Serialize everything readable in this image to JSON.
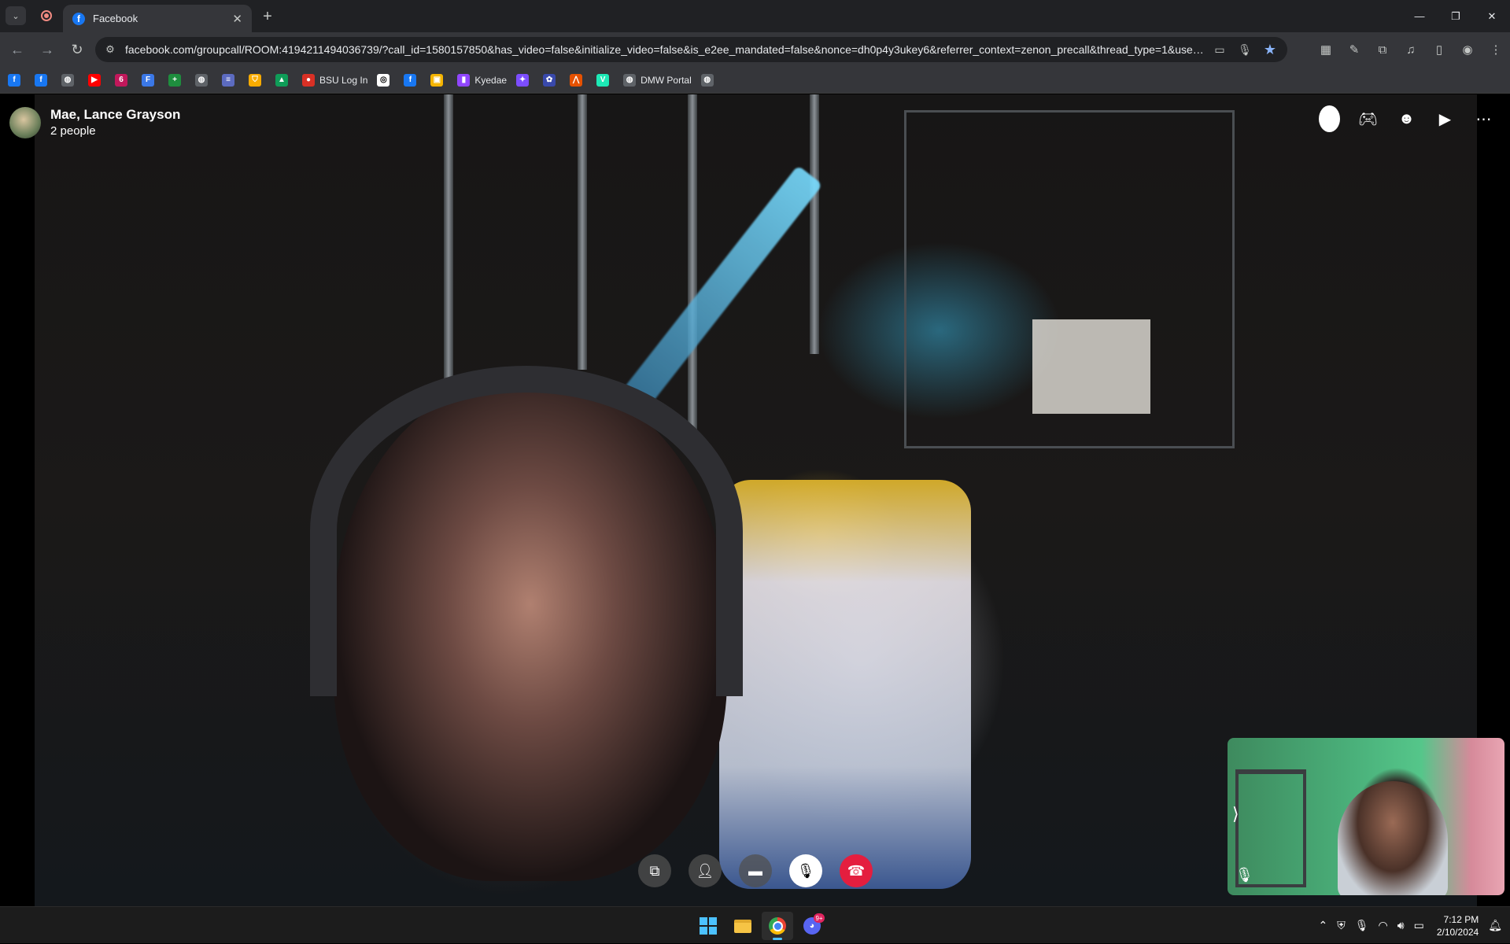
{
  "browser": {
    "tab": {
      "title": "Facebook",
      "close": "✕"
    },
    "new_tab": "+",
    "window_controls": {
      "minimize": "—",
      "restore": "❐",
      "close": "✕"
    },
    "address": {
      "host": "facebook.com",
      "path": "/groupcall/ROOM:4194211494036739/?call_id=1580157850&has_video=false&initialize_video=false&is_e2ee_mandated=false&nonce=dh0p4y3ukey6&referrer_context=zenon_precall&thread_type=1&users..."
    },
    "bookmarks": [
      {
        "label": "",
        "icon": "facebook",
        "color": "#1877f2",
        "glyph": "f"
      },
      {
        "label": "",
        "icon": "facebook",
        "color": "#1877f2",
        "glyph": "f"
      },
      {
        "label": "",
        "icon": "globe",
        "color": "#5f6368",
        "glyph": "◍"
      },
      {
        "label": "",
        "icon": "youtube",
        "color": "#ff0000",
        "glyph": "▶"
      },
      {
        "label": "",
        "icon": "app-624",
        "color": "#c2185b",
        "glyph": "6"
      },
      {
        "label": "",
        "icon": "forms",
        "color": "#3b78e7",
        "glyph": "F"
      },
      {
        "label": "",
        "icon": "sheets",
        "color": "#1e8e3e",
        "glyph": "+"
      },
      {
        "label": "",
        "icon": "globe",
        "color": "#5f6368",
        "glyph": "◍"
      },
      {
        "label": "",
        "icon": "app",
        "color": "#5c6bc0",
        "glyph": "≡"
      },
      {
        "label": "",
        "icon": "shield",
        "color": "#f9ab00",
        "glyph": "⛉"
      },
      {
        "label": "",
        "icon": "drive",
        "color": "#0f9d58",
        "glyph": "▲"
      },
      {
        "label": "BSU Log In",
        "icon": "bsu",
        "color": "#d93025",
        "glyph": "●"
      },
      {
        "label": "",
        "icon": "app",
        "color": "#ffffff",
        "glyph": "◎"
      },
      {
        "label": "",
        "icon": "facebook",
        "color": "#1877f2",
        "glyph": "f"
      },
      {
        "label": "",
        "icon": "image",
        "color": "#f4b400",
        "glyph": "▣"
      },
      {
        "label": "Kyedae",
        "icon": "twitch",
        "color": "#9146ff",
        "glyph": "▮"
      },
      {
        "label": "",
        "icon": "app",
        "color": "#7c4dff",
        "glyph": "✦"
      },
      {
        "label": "",
        "icon": "app",
        "color": "#3949ab",
        "glyph": "✿"
      },
      {
        "label": "",
        "icon": "app",
        "color": "#e65100",
        "glyph": "⋀"
      },
      {
        "label": "",
        "icon": "vuetify",
        "color": "#1de9b6",
        "glyph": "V"
      },
      {
        "label": "DMW Portal",
        "icon": "globe",
        "color": "#5f6368",
        "glyph": "◍"
      },
      {
        "label": "",
        "icon": "globe",
        "color": "#5f6368",
        "glyph": "◍"
      }
    ]
  },
  "call": {
    "title": "Mae, Lance Grayson",
    "subtitle": "2 people"
  },
  "taskbar": {
    "time": "7:12 PM",
    "date": "2/10/2024",
    "discord_badge": "9+"
  }
}
